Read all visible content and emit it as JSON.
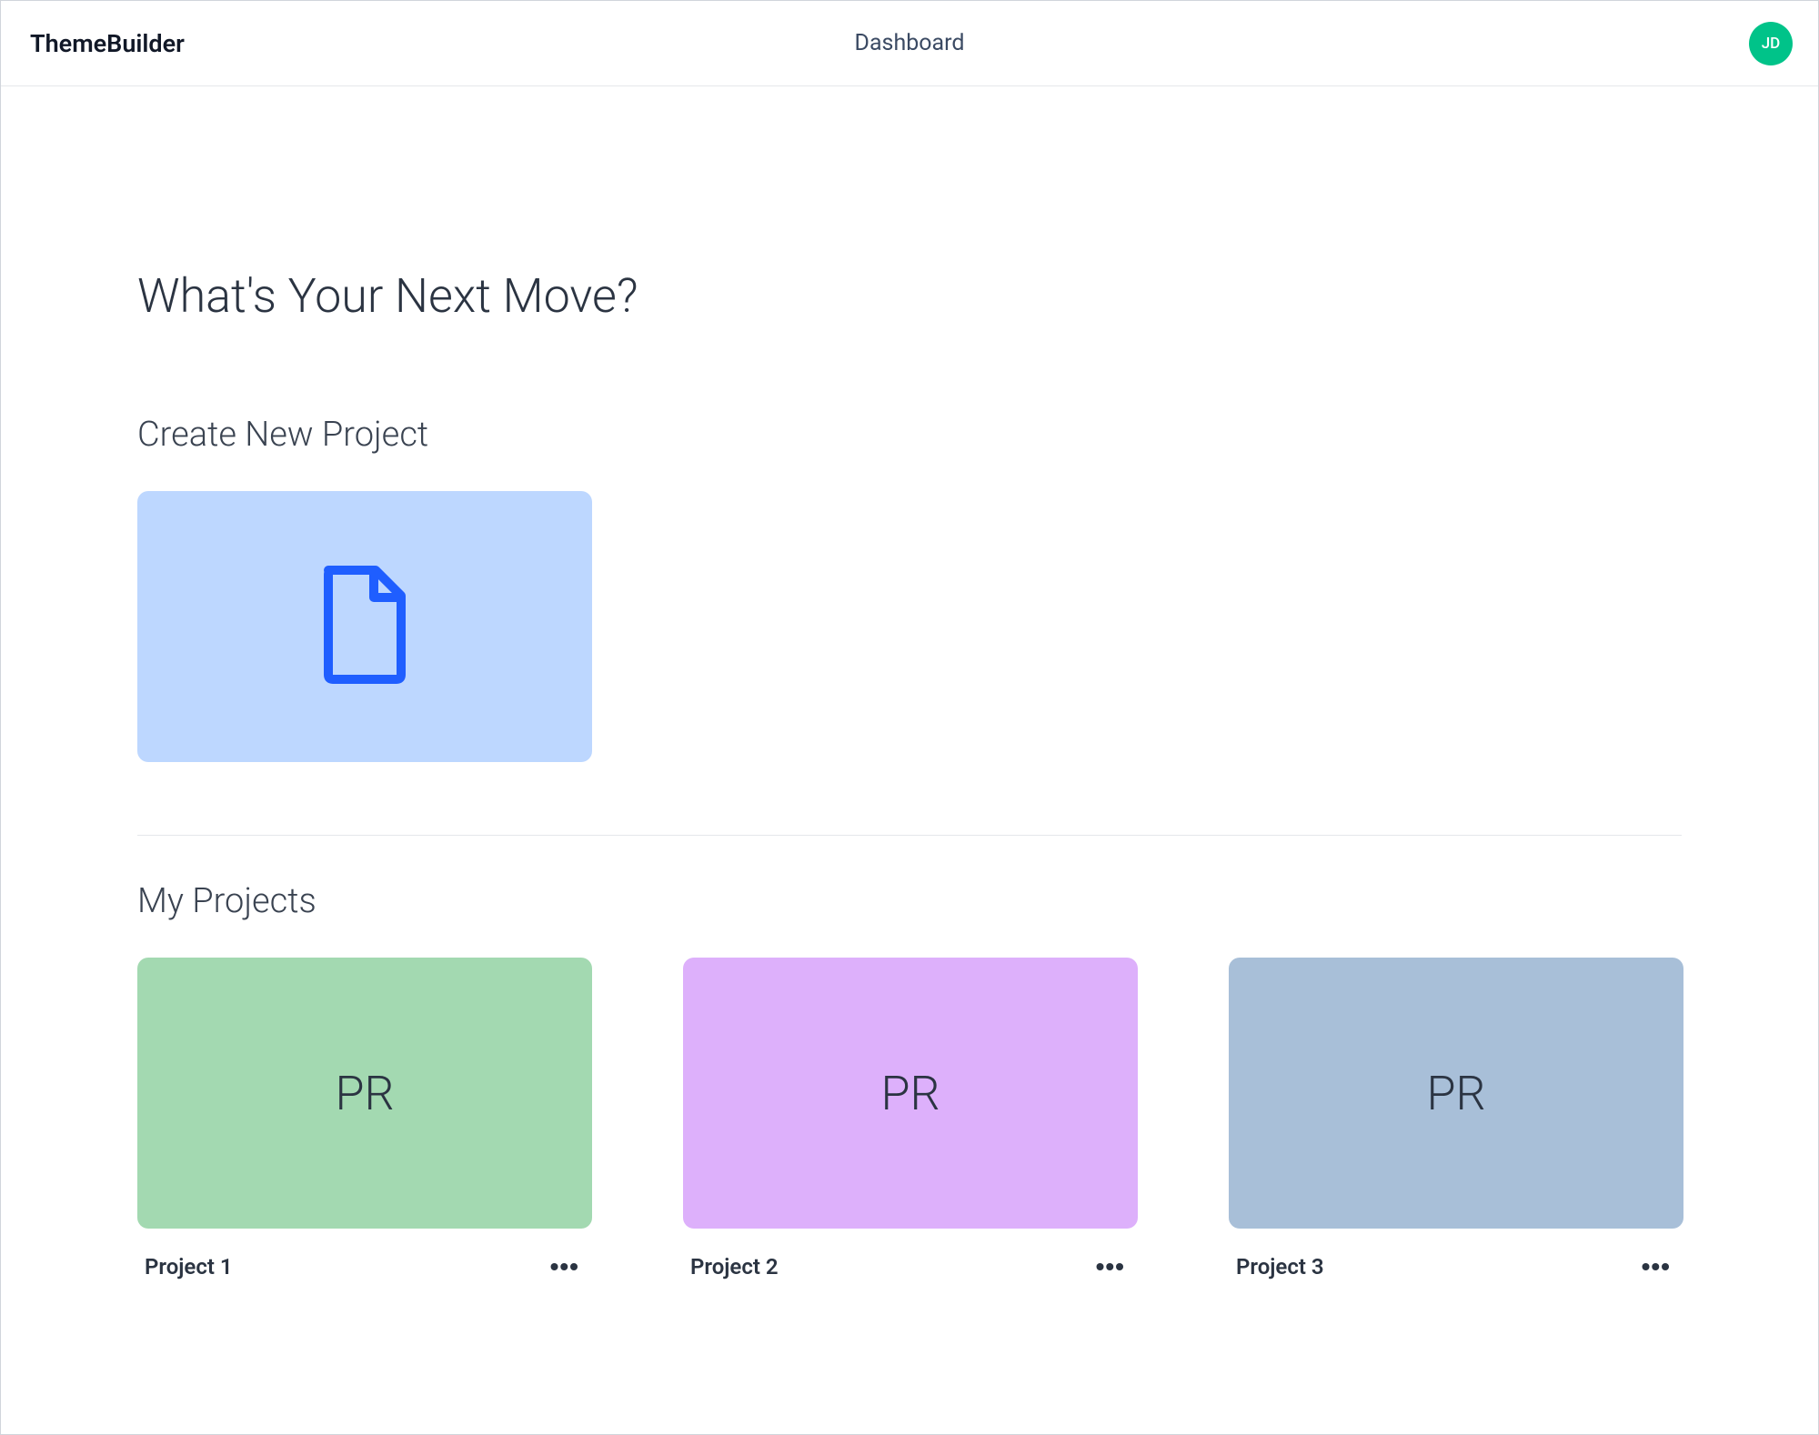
{
  "header": {
    "app_title": "ThemeBuilder",
    "page_label": "Dashboard",
    "avatar_initials": "JD"
  },
  "hero": {
    "title": "What's Your Next Move?"
  },
  "create_section": {
    "title": "Create New Project"
  },
  "projects_section": {
    "title": "My Projects",
    "items": [
      {
        "badge": "PR",
        "name": "Project 1",
        "color": "#a3d9b1"
      },
      {
        "badge": "PR",
        "name": "Project 2",
        "color": "#ddb0fb"
      },
      {
        "badge": "PR",
        "name": "Project 3",
        "color": "#a8bfd8"
      }
    ]
  }
}
